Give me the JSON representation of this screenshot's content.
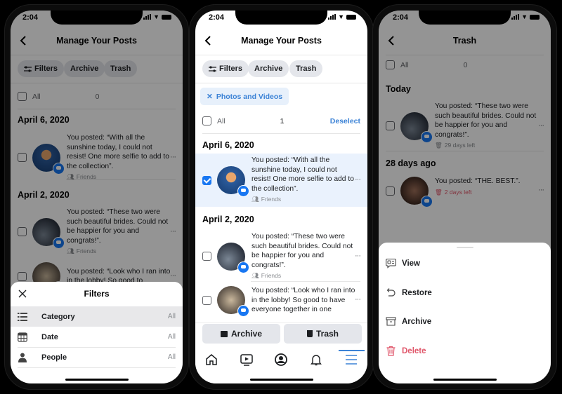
{
  "status": {
    "time": "2:04"
  },
  "colors": {
    "accent": "#1877f2",
    "danger": "#e0566a",
    "chip_bg": "#e4e6eb",
    "selected_bg": "#eaf2fd"
  },
  "screen1": {
    "title": "Manage Your Posts",
    "chips": [
      "Filters",
      "Archive",
      "Trash"
    ],
    "all_label": "All",
    "count": "0",
    "groups": [
      {
        "date": "April 6, 2020",
        "posts": [
          {
            "text": "You posted: “With all the sunshine today, I could not resist! One more selfie to add to the collection”.",
            "audience": "Friends"
          }
        ]
      },
      {
        "date": "April 2, 2020",
        "posts": [
          {
            "text": "You posted: “These two were such beautiful brides. Could not be happier for you and congrats!”.",
            "audience": "Friends"
          },
          {
            "text": "You posted: “Look who I ran into in the lobby! So good to"
          }
        ]
      }
    ],
    "filters_sheet": {
      "title": "Filters",
      "rows": [
        {
          "icon": "list-icon",
          "label": "Category",
          "value": "All"
        },
        {
          "icon": "calendar-icon",
          "label": "Date",
          "value": "All"
        },
        {
          "icon": "person-icon",
          "label": "People",
          "value": "All"
        }
      ]
    }
  },
  "screen2": {
    "title": "Manage Your Posts",
    "chips": [
      "Filters",
      "Archive",
      "Trash"
    ],
    "active_filter": "Photos and Videos",
    "all_label": "All",
    "count": "1",
    "deselect": "Deselect",
    "groups": [
      {
        "date": "April 6, 2020",
        "posts": [
          {
            "text": "You posted: “With all the sunshine today, I could not resist! One more selfie to add to the collection”.",
            "audience": "Friends",
            "selected": true
          }
        ]
      },
      {
        "date": "April 2, 2020",
        "posts": [
          {
            "text": "You posted: “These two were such beautiful brides. Could not be happier for you and congrats!”.",
            "audience": "Friends"
          },
          {
            "text": "You posted: “Look who I ran into in the lobby! So good to have everyone together in one"
          }
        ]
      }
    ],
    "actions": [
      "Archive",
      "Trash"
    ],
    "tabs": [
      "home-icon",
      "watch-icon",
      "profile-icon",
      "bell-icon",
      "menu-icon"
    ],
    "active_tab": "menu-icon"
  },
  "screen3": {
    "title": "Trash",
    "all_label": "All",
    "count": "0",
    "groups": [
      {
        "date": "Today",
        "posts": [
          {
            "text": "You posted: “These two were such beautiful brides. Could not be happier for you and congrats!”.",
            "remaining": "29 days left"
          }
        ]
      },
      {
        "date": "28 days ago",
        "posts": [
          {
            "text": "You posted: “THE. BEST.”.",
            "remaining": "2 days left",
            "urgent": true
          }
        ]
      }
    ],
    "menu": [
      {
        "icon": "view-icon",
        "label": "View"
      },
      {
        "icon": "restore-icon",
        "label": "Restore"
      },
      {
        "icon": "archive-icon",
        "label": "Archive"
      },
      {
        "icon": "trash-icon",
        "label": "Delete",
        "danger": true
      }
    ]
  }
}
